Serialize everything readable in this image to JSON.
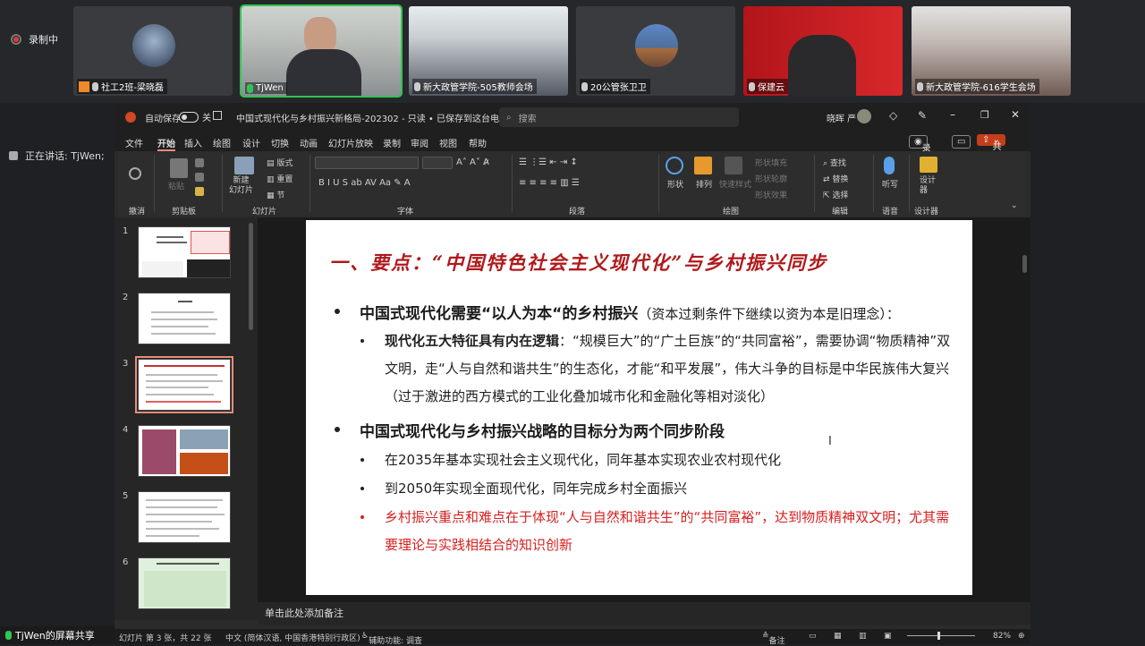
{
  "meeting": {
    "recording_label": "录制中",
    "participants": [
      {
        "name": "社工2班-梁晓磊"
      },
      {
        "name": "TjWen"
      },
      {
        "name": "新大政管学院-505教师会场"
      },
      {
        "name": "20公管张卫卫"
      },
      {
        "name": "保建云"
      },
      {
        "name": "新大政管学院-616学生会场"
      }
    ],
    "speaking": "正在讲话: TjWen;",
    "screen_share": "TjWen的屏幕共享"
  },
  "titlebar": {
    "autosave": "自动保存",
    "autosave_state": "关",
    "doc_title": "中国式现代化与乡村振兴新格局-202302 - 只读 • 已保存到这台电脑 ⌄",
    "search": "搜索",
    "user": "晓晖 严"
  },
  "menu": {
    "items": [
      "文件",
      "开始",
      "插入",
      "绘图",
      "设计",
      "切换",
      "动画",
      "幻灯片放映",
      "录制",
      "审阅",
      "视图",
      "帮助"
    ],
    "record": "录制",
    "share": "共享"
  },
  "ribbon": {
    "undo_group": "撤消",
    "clipboard_group": "剪贴板",
    "paste": "粘贴",
    "new_slide": "新建\n幻灯片",
    "layout": "版式",
    "reset": "重置",
    "section": "节",
    "slides_group": "幻灯片",
    "font_group": "字体",
    "paragraph_group": "段落",
    "shapes": "形状",
    "arrange": "排列",
    "quick_styles": "快速样式",
    "shape_fill": "形状填充",
    "shape_outline": "形状轮廓",
    "shape_effects": "形状效果",
    "drawing_group": "绘图",
    "find": "查找",
    "replace": "替换",
    "select": "选择",
    "editing_group": "编辑",
    "dictate": "听写",
    "voice_group": "语音",
    "designer": "设计器",
    "designer_group": "设计器"
  },
  "thumbnails": [
    "1",
    "2",
    "3",
    "4",
    "5",
    "6"
  ],
  "slide": {
    "title": "一、要点：“中国特色社会主义现代化”与乡村振兴同步",
    "b1_main": "中国式现代化需要“以人为本“的乡村振兴",
    "b1_sub": "（资本过剩条件下继续以资为本是旧理念）：",
    "b1_detail_bold": "现代化五大特征具有内在逻辑",
    "b1_detail_rest": "：“规模巨大”的“广土巨族”的“共同富裕”，需要协调“物质精神”双文明，走“人与自然和谐共生”的生态化，才能“和平发展”，伟大斗争的目标是中华民族伟大复兴（过于激进的西方模式的工业化叠加城市化和金融化等相对淡化）",
    "b2_main": "中国式现代化与乡村振兴战略的目标分为两个同步阶段",
    "b2_item1": "在2035年基本实现社会主义现代化，同年基本实现农业农村现代化",
    "b2_item2": "到2050年实现全面现代化，同年完成乡村全面振兴",
    "b2_item3": "乡村振兴重点和难点在于体现“人与自然和谐共生”的“共同富裕”，达到物质精神双文明；尤其需要理论与实践相结合的知识创新"
  },
  "notes_placeholder": "单击此处添加备注",
  "status": {
    "slide_count": "幻灯片 第 3 张，共 22 张",
    "language": "中文 (简体汉语, 中国香港特别行政区)",
    "accessibility": "辅助功能: 调查",
    "notes": "备注",
    "zoom": "82%"
  }
}
